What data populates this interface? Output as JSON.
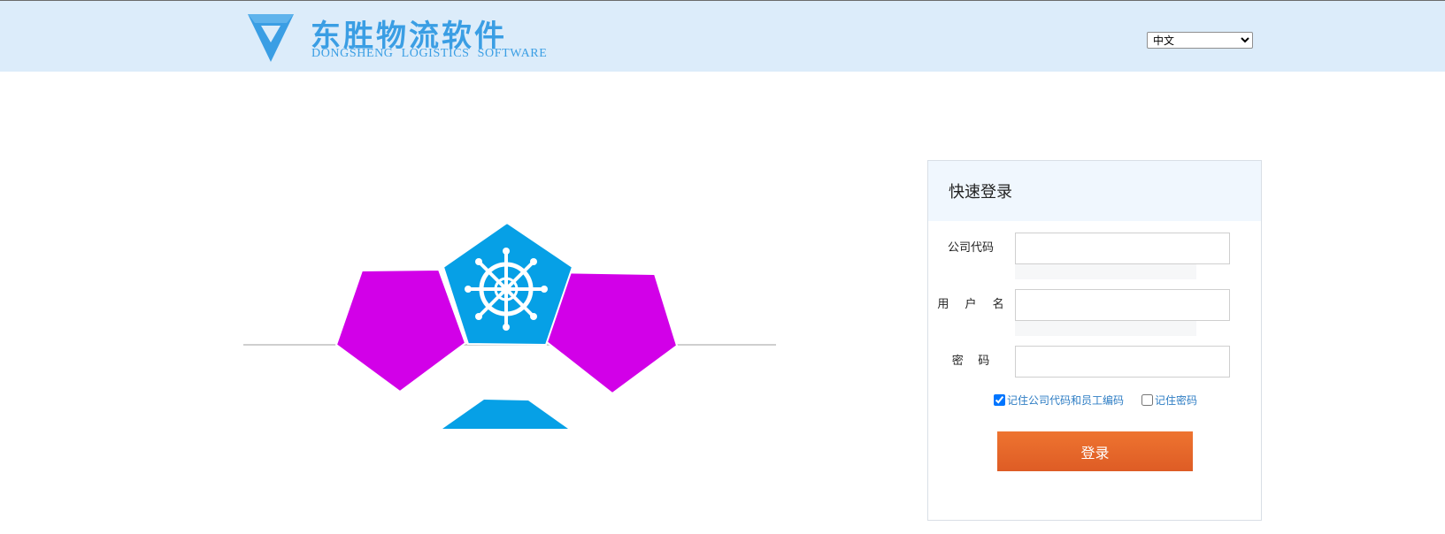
{
  "header": {
    "brand_cn": "东胜物流软件",
    "brand_en": "DONGSHENG LOGISTICS SOFTWARE",
    "logo_icon": "diamond-logo-icon",
    "language": {
      "selected": "中文",
      "options": [
        "中文"
      ]
    }
  },
  "illustration": {
    "center_icon": "ship-wheel-icon",
    "colors": {
      "blue": "#06a0e6",
      "magenta": "#d200e8",
      "line": "#cfcfcf"
    }
  },
  "login": {
    "title": "快速登录",
    "fields": {
      "company_code": {
        "label": "公司代码",
        "value": ""
      },
      "username": {
        "label": "用 户 名",
        "value": ""
      },
      "password": {
        "label": "密    码",
        "value": ""
      }
    },
    "remember_code": {
      "label": "记住公司代码和员工编码",
      "checked": true
    },
    "remember_password": {
      "label": "记住密码",
      "checked": false
    },
    "submit_label": "登录"
  },
  "colors": {
    "header_bg": "#dcecfa",
    "brand": "#3a9ee4",
    "accent_button": "#e4662a",
    "link": "#2e7dc4"
  }
}
